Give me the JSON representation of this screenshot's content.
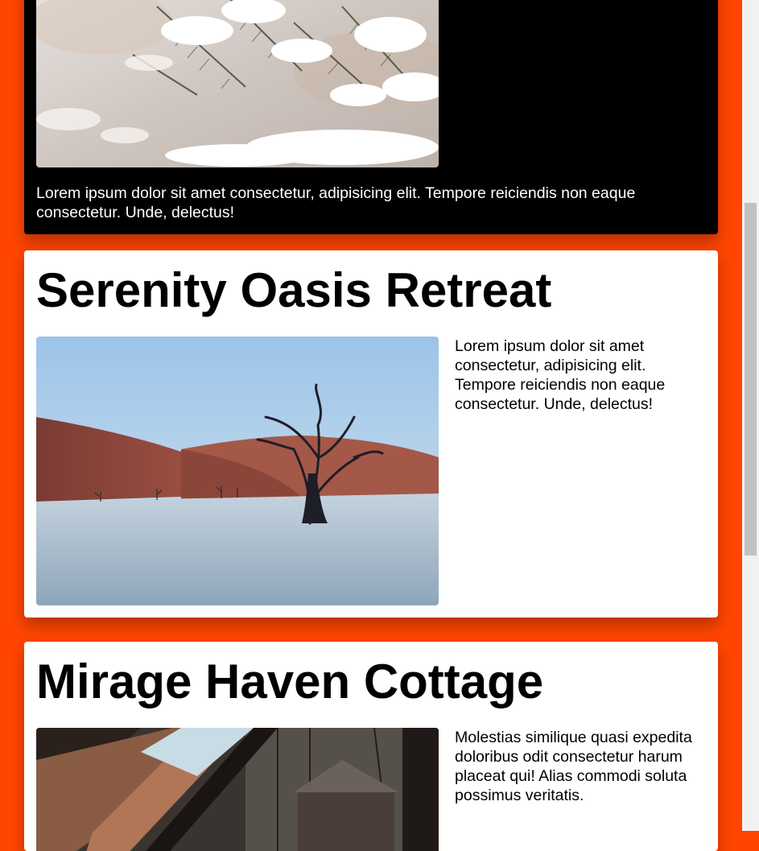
{
  "cards": [
    {
      "image": "snowy-pine-branch",
      "text": "Lorem ipsum dolor sit amet consectetur, adipisicing elit. Tempore reiciendis non eaque consectetur. Unde, delectus!"
    },
    {
      "title": "Serenity Oasis Retreat",
      "image": "desert-dead-tree",
      "text": "Lorem ipsum dolor sit amet consectetur, adipisicing elit. Tempore reiciendis non eaque consectetur. Unde, delectus!"
    },
    {
      "title": "Mirage Haven Cottage",
      "image": "cabin-interior",
      "text": "Molestias similique quasi expedita doloribus odit consectetur harum placeat qui! Alias commodi soluta possimus veritatis."
    }
  ],
  "colors": {
    "page_background": "#ff4500",
    "card_light": "#ffffff",
    "card_dark": "#000000"
  }
}
